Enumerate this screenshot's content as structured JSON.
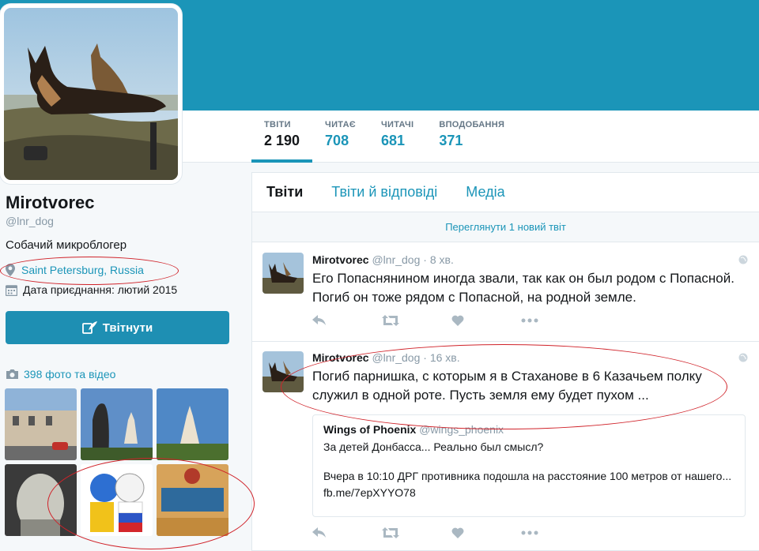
{
  "profile": {
    "name": "Mirotvorec",
    "handle": "@lnr_dog",
    "bio": "Собачий микроблогер",
    "location": "Saint Petersburg, Russia",
    "joined": "Дата приєднання: лютий 2015",
    "tweet_button": "Твітнути",
    "media_link": "398 фото та відео"
  },
  "stats": [
    {
      "label": "ТВІТИ",
      "value": "2 190"
    },
    {
      "label": "ЧИТАЄ",
      "value": "708"
    },
    {
      "label": "ЧИТАЧІ",
      "value": "681"
    },
    {
      "label": "ВПОДОБАННЯ",
      "value": "371"
    }
  ],
  "tabs": [
    "Твіти",
    "Твіти й відповіді",
    "Медіа"
  ],
  "new_tweets_bar": "Переглянути 1 новий твіт",
  "tweets": [
    {
      "name": "Mirotvorec",
      "handle": "@lnr_dog",
      "time": "· 8 хв.",
      "text": "Его Попаснянином иногда звали, так как он был родом с Попасной. Погиб он тоже рядом с Попасной, на родной земле."
    },
    {
      "name": "Mirotvorec",
      "handle": "@lnr_dog",
      "time": "· 16 хв.",
      "text": "Погиб парнишка, с которым я в Стаханове в 6 Казачьем полку служил в одной роте. Пусть земля ему будет пухом ...",
      "quote": {
        "name": "Wings of Phoenix",
        "handle": "@wings_phoenix",
        "line1": "За детей Донбасса... Реально был смысл?",
        "line2": "Вчера в 10:10 ДРГ противника подошла на расстояние 100 метров от нашего... fb.me/7epXYYO78"
      }
    }
  ],
  "colors": {
    "accent": "#1b95b8",
    "annotation": "#d0232a"
  }
}
